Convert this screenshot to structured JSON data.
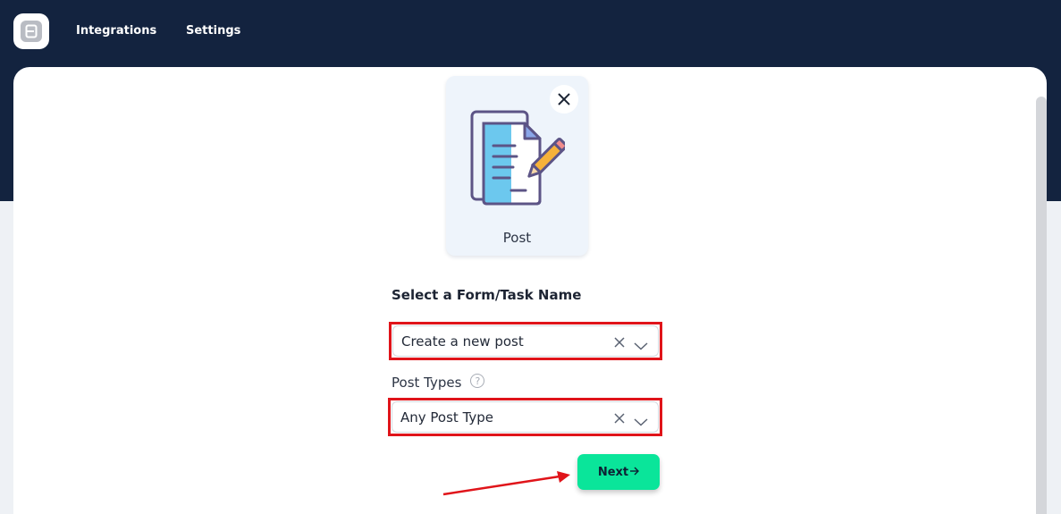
{
  "nav": {
    "logo_icon": "app-logo-icon",
    "links": [
      {
        "label": "Integrations"
      },
      {
        "label": "Settings"
      }
    ]
  },
  "trigger_card": {
    "label": "Post",
    "icon": "post-document-pencil-icon",
    "close_icon": "close-icon"
  },
  "form": {
    "section_title": "Select a Form/Task Name",
    "form_select": {
      "value": "Create a new post",
      "clear_icon": "clear-icon",
      "chevron_icon": "chevron-down-icon"
    },
    "post_types_label": "Post Types",
    "post_types_help_icon": "help-icon",
    "post_types_select": {
      "value": "Any Post Type",
      "clear_icon": "clear-icon",
      "chevron_icon": "chevron-down-icon"
    },
    "next_label": "Next",
    "next_icon": "arrow-right-icon"
  },
  "colors": {
    "topbar": "#13233f",
    "accent_button": "#0ae59a",
    "highlight_outline": "#e0141a",
    "card_bg": "#eef4fb"
  }
}
